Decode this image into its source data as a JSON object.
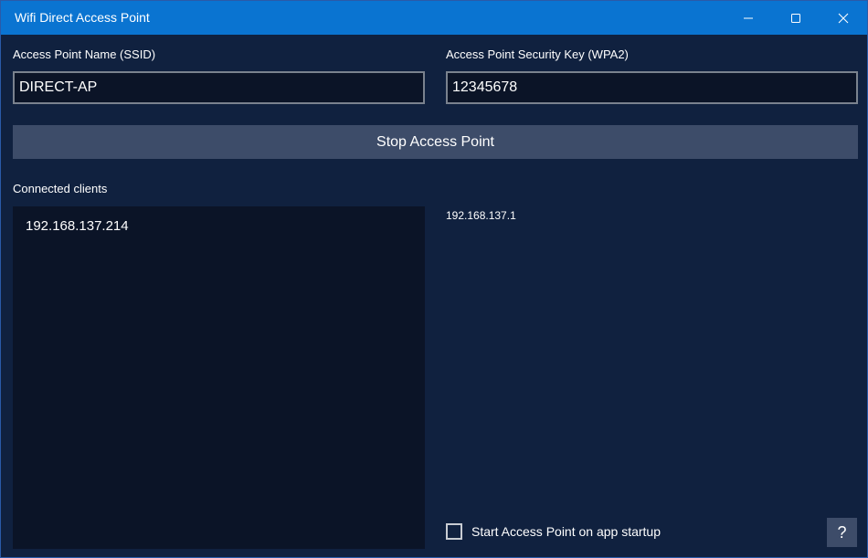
{
  "window": {
    "title": "Wifi Direct Access Point",
    "titlebar_color": "#0a74d1",
    "background_color": "#10213f"
  },
  "ssid": {
    "label": "Access Point Name (SSID)",
    "value": "DIRECT-AP"
  },
  "security_key": {
    "label": "Access Point Security Key (WPA2)",
    "value": "12345678"
  },
  "toggle_button": {
    "label": "Stop Access Point"
  },
  "clients": {
    "label": "Connected clients",
    "items": [
      "192.168.137.214"
    ]
  },
  "access_point_ip": "192.168.137.1",
  "startup_option": {
    "label": "Start Access Point on app startup",
    "checked": false
  },
  "help_button": {
    "label": "?"
  },
  "icons": {
    "minimize": "minimize-icon",
    "maximize": "maximize-icon",
    "close": "close-icon"
  }
}
